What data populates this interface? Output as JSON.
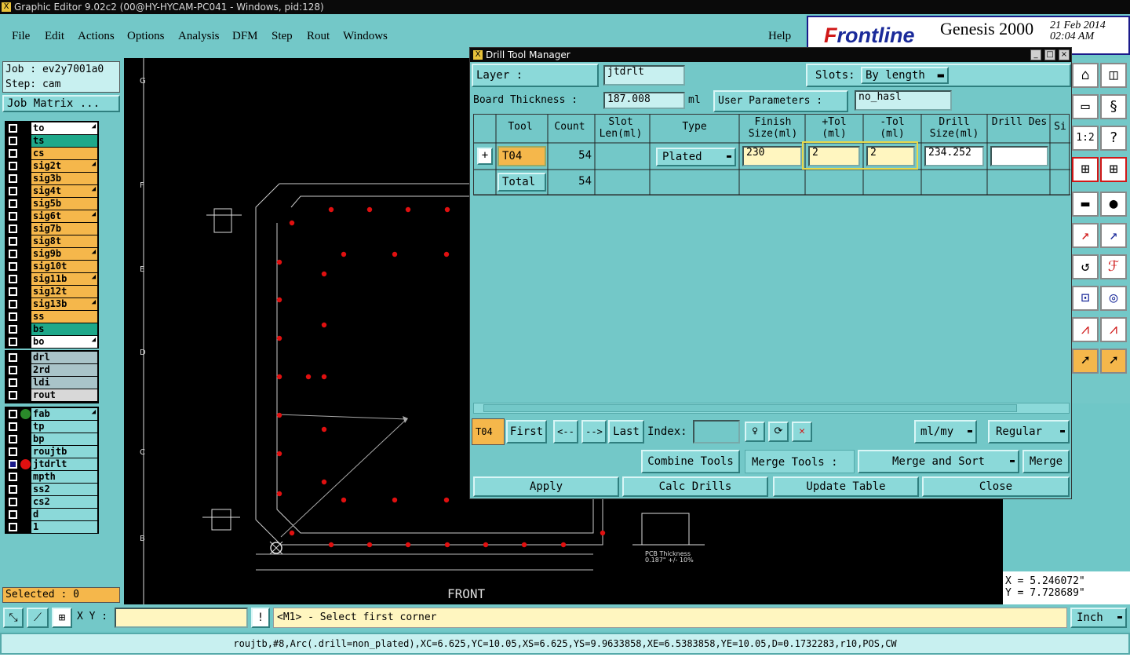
{
  "window": {
    "title": "Graphic Editor 9.02c2 (00@HY-HYCAM-PC041 - Windows, pid:128)"
  },
  "menu": {
    "items": [
      "File",
      "Edit",
      "Actions",
      "Options",
      "Analysis",
      "DFM",
      "Step",
      "Rout",
      "Windows"
    ],
    "help": "Help"
  },
  "brand": {
    "logo_rest": "rontline",
    "logo_f": "F",
    "product": "Genesis 2000",
    "date": "21 Feb 2014",
    "time": "02:04 AM"
  },
  "left": {
    "job": "Job : ev2y7001a0",
    "step": "Step: cam",
    "job_matrix": "Job Matrix ...",
    "selected": "Selected : 0",
    "layers": [
      {
        "name": "to",
        "color": "#ffffff",
        "arrow": true
      },
      {
        "name": "ts",
        "color": "#1ea88a",
        "arrow": false
      },
      {
        "name": "cs",
        "color": "#f5b74b",
        "arrow": false
      },
      {
        "name": "sig2t",
        "color": "#f5b74b",
        "arrow": true
      },
      {
        "name": "sig3b",
        "color": "#f5b74b",
        "arrow": false
      },
      {
        "name": "sig4t",
        "color": "#f5b74b",
        "arrow": true
      },
      {
        "name": "sig5b",
        "color": "#f5b74b",
        "arrow": false
      },
      {
        "name": "sig6t",
        "color": "#f5b74b",
        "arrow": true
      },
      {
        "name": "sig7b",
        "color": "#f5b74b",
        "arrow": false
      },
      {
        "name": "sig8t",
        "color": "#f5b74b",
        "arrow": false
      },
      {
        "name": "sig9b",
        "color": "#f5b74b",
        "arrow": true
      },
      {
        "name": "sig10t",
        "color": "#f5b74b",
        "arrow": false
      },
      {
        "name": "sig11b",
        "color": "#f5b74b",
        "arrow": true
      },
      {
        "name": "sig12t",
        "color": "#f5b74b",
        "arrow": false
      },
      {
        "name": "sig13b",
        "color": "#f5b74b",
        "arrow": true
      },
      {
        "name": "ss",
        "color": "#f5b74b",
        "arrow": false
      },
      {
        "name": "bs",
        "color": "#1ea88a",
        "arrow": false
      },
      {
        "name": "bo",
        "color": "#ffffff",
        "arrow": true
      }
    ],
    "drill_layers": [
      {
        "name": "drl",
        "color": "#a9c4c9"
      },
      {
        "name": "2rd",
        "color": "#a9c4c9"
      },
      {
        "name": "ldi",
        "color": "#a9c4c9"
      },
      {
        "name": "rout",
        "color": "#d8d8d8"
      }
    ],
    "misc_layers": [
      {
        "name": "fab",
        "color": "#8bd9d9",
        "arrow": true,
        "dot": "#2a8a2a"
      },
      {
        "name": "tp",
        "color": "#8bd9d9"
      },
      {
        "name": "bp",
        "color": "#8bd9d9"
      },
      {
        "name": "roujtb",
        "color": "#8bd9d9"
      },
      {
        "name": "jtdrlt",
        "color": "#8bd9d9",
        "dot": "#e01010",
        "selected": true
      },
      {
        "name": "mpth",
        "color": "#8bd9d9"
      },
      {
        "name": "ss2",
        "color": "#8bd9d9"
      },
      {
        "name": "cs2",
        "color": "#8bd9d9"
      },
      {
        "name": "d",
        "color": "#8bd9d9"
      },
      {
        "name": "1",
        "color": "#8bd9d9"
      }
    ]
  },
  "dialog": {
    "title": "Drill Tool Manager",
    "layer_label": "Layer          :",
    "layer_value": "jtdrlt",
    "slots_label": "Slots:",
    "slots_value": "By length",
    "board_thickness_label": "Board Thickness :",
    "board_thickness_value": "187.008",
    "board_unit": "ml",
    "user_params_label": "User Parameters :",
    "user_params_value": "no_hasl",
    "columns": [
      "Tool",
      "Count",
      "Slot Len(ml)",
      "Type",
      "Finish Size(ml)",
      "+Tol (ml)",
      "-Tol (ml)",
      "Drill Size(ml)",
      "Drill Des",
      "Si"
    ],
    "row": {
      "tool": "T04",
      "count": "54",
      "type": "Plated",
      "finish": "230",
      "ptol": "2",
      "mtol": "2",
      "drill": "234.252",
      "des": ""
    },
    "total": {
      "label": "Total",
      "count": "54"
    },
    "nav": {
      "current": "T04",
      "first": "First",
      "prev": "<--",
      "next": "-->",
      "last": "Last",
      "index": "Index:",
      "units": "ml/my",
      "mode": "Regular"
    },
    "combine": "Combine Tools",
    "merge_label": "Merge Tools :",
    "merge_value": "Merge and Sort",
    "merge": "Merge",
    "apply": "Apply",
    "calc": "Calc Drills",
    "update": "Update Table",
    "close": "Close"
  },
  "coords": {
    "x": "X = 5.246072\"",
    "y": "Y = 7.728689\""
  },
  "status": {
    "xy_label": "X Y :",
    "prompt": "<M1> - Select first corner",
    "units": "Inch"
  },
  "footer": "roujtb,#8,Arc(.drill=non_plated),XC=6.625,YC=10.05,XS=6.625,YS=9.9633858,XE=6.5383858,YE=10.05,D=0.1732283,r10,POS,CW",
  "canvas": {
    "ruler": [
      "G",
      "F",
      "E",
      "D",
      "C",
      "B"
    ],
    "front": "FRONT",
    "pcb_note": "PCB Thickness",
    "pcb_tol": "0.187\" +/- 10%"
  }
}
